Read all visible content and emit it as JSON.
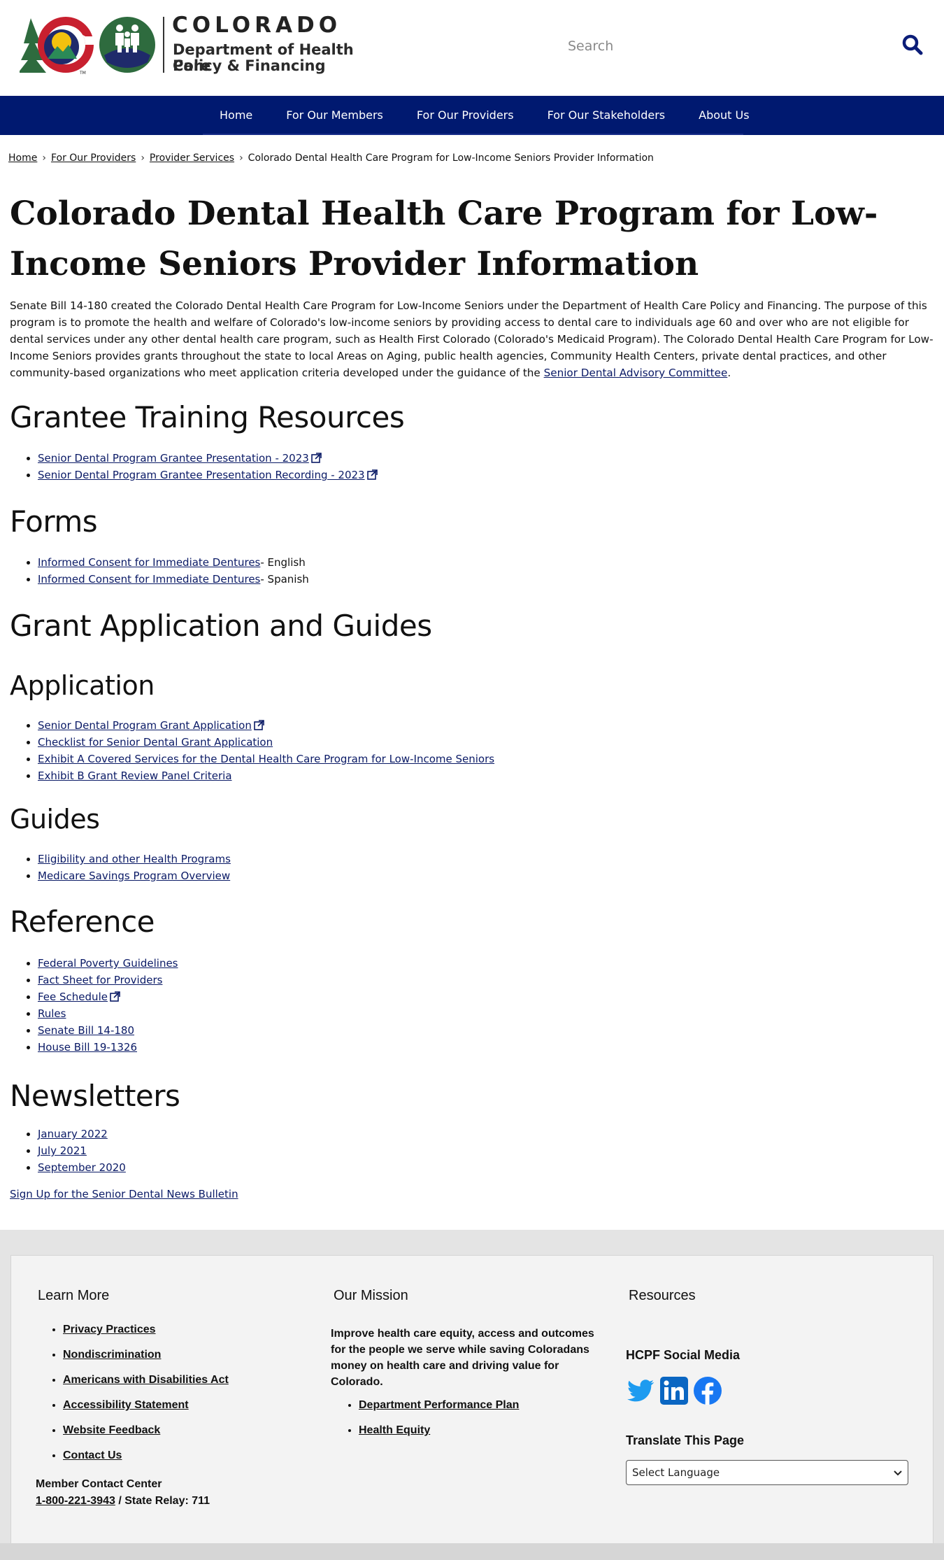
{
  "header": {
    "wordmark": "COLORADO",
    "dept_line1": "Department of Health Care",
    "dept_line2": "Policy & Financing",
    "hcpf_badge": "HCPF",
    "search_placeholder": "Search"
  },
  "nav": {
    "items": [
      "Home",
      "For Our Members",
      "For Our Providers",
      "For Our Stakeholders",
      "About Us"
    ]
  },
  "breadcrumb": {
    "items": [
      "Home",
      "For Our Providers",
      "Provider Services"
    ],
    "current": "Colorado Dental Health Care Program for Low-Income Seniors Provider Information",
    "separator": "›"
  },
  "page": {
    "title": "Colorado Dental Health Care Program for Low-Income Seniors Provider Information",
    "intro_text": "Senate Bill 14-180 created the Colorado Dental Health Care Program for Low-Income Seniors under the Department of Health Care Policy and Financing. The purpose of this program is to promote the health and welfare of Colorado's low-income seniors by providing access to dental care to individuals age 60 and over who are not eligible for dental services under any other dental health care program, such as Health First Colorado (Colorado's Medicaid Program). The Colorado Dental Health Care Program for Low-Income Seniors provides grants throughout the state to local Areas on Aging, public health agencies, Community Health Centers, private dental practices, and other community-based organizations who meet application criteria developed under the guidance of the ",
    "intro_link": "Senior Dental Advisory Committee",
    "intro_end": "."
  },
  "sections": {
    "grantee_training": {
      "heading": "Grantee Training Resources",
      "links": [
        "Senior Dental Program Grantee Presentation - 2023",
        "Senior Dental Program Grantee Presentation Recording - 2023"
      ]
    },
    "forms": {
      "heading": "Forms",
      "links": [
        "Informed Consent for Immediate Dentures",
        "Informed Consent for Immediate Dentures"
      ],
      "suffixes": [
        "- English",
        "- Spanish"
      ]
    },
    "grant_application": {
      "heading": "Grant Application and Guides"
    },
    "application": {
      "heading": "Application",
      "links": [
        "Senior Dental Program Grant Application",
        "Checklist for Senior Dental Grant Application",
        "Exhibit A Covered Services for the Dental Health Care Program for Low-Income Seniors",
        "Exhibit B Grant Review Panel Criteria"
      ]
    },
    "guides": {
      "heading": "Guides",
      "links": [
        "Eligibility and other Health Programs",
        "Medicare Savings Program Overview"
      ]
    },
    "reference": {
      "heading": "Reference",
      "links": [
        "Federal Poverty Guidelines",
        "Fact Sheet for Providers",
        "Fee Schedule",
        "Rules",
        "Senate Bill 14-180",
        "House Bill 19-1326"
      ]
    },
    "newsletters": {
      "heading": "Newsletters",
      "links": [
        "January 2022",
        "July 2021",
        "September 2020"
      ],
      "signup": "Sign Up for the Senior Dental News Bulletin"
    }
  },
  "footer": {
    "learn_more": {
      "heading": "Learn More",
      "links": [
        "Privacy Practices",
        "Nondiscrimination",
        "Americans with Disabilities Act",
        "Accessibility Statement",
        "Website Feedback",
        "Contact Us"
      ],
      "contact_label": "Member Contact Center",
      "phone": "1-800-221-3943",
      "relay": " / State Relay: 711"
    },
    "mission": {
      "heading": "Our Mission",
      "text": "Improve health care equity, access and outcomes for the people we serve while saving Coloradans money on health care and driving value for Colorado.",
      "links": [
        "Department Performance Plan",
        "Health Equity"
      ]
    },
    "resources": {
      "heading": "Resources",
      "social_heading": "HCPF Social Media",
      "social_icons": [
        "twitter-icon",
        "linkedin-icon",
        "facebook-icon"
      ],
      "translate_heading": "Translate This Page",
      "language_selected": "Select Language"
    }
  },
  "colors": {
    "nav_bg": "#001970",
    "link": "#0a1a66",
    "footer_bg": "#e4e4e4",
    "social_blue": "#1d9bf0",
    "linkedin": "#0a66c2",
    "facebook": "#1877f2"
  }
}
